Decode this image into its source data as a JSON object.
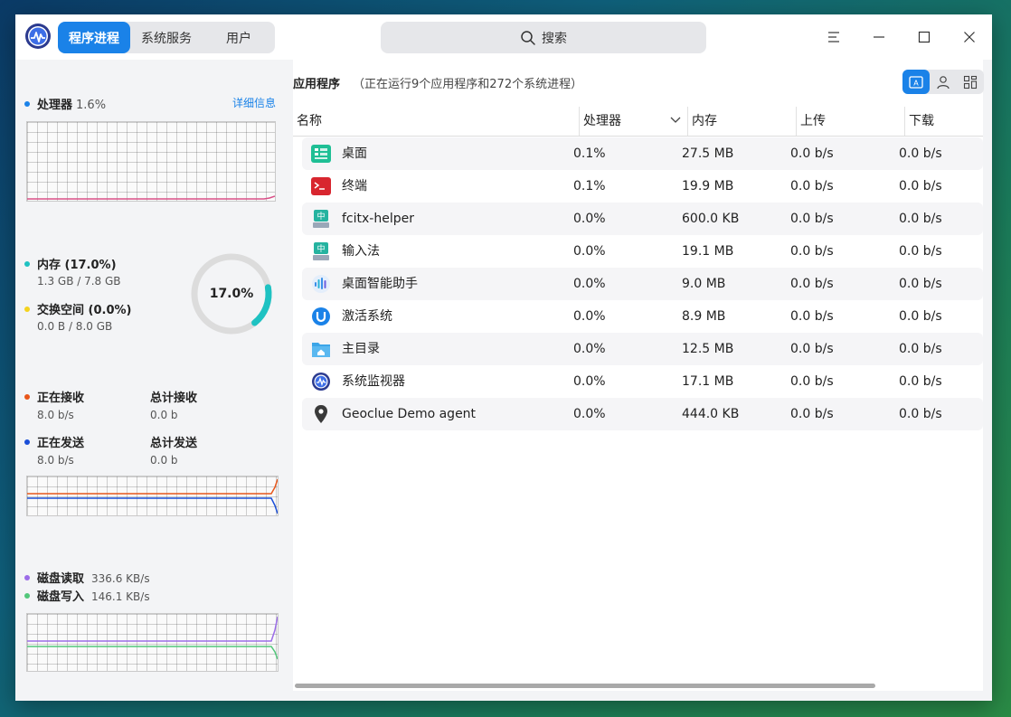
{
  "tabs": [
    {
      "label": "程序进程",
      "active": true
    },
    {
      "label": "系统服务",
      "active": false
    },
    {
      "label": "用户",
      "active": false
    }
  ],
  "search": {
    "label": "搜索",
    "icon": "search-icon"
  },
  "colors": {
    "accent": "#1a82e8",
    "cpu": "#1a82e8",
    "cpu_line": "#d94f87",
    "memory": "#1ec2c2",
    "swap": "#f4d31e",
    "net_recv": "#e8561a",
    "net_send": "#1a4ed8",
    "disk_read": "#9b6ce8",
    "disk_write": "#52c77a"
  },
  "cpu": {
    "label": "处理器",
    "value": "1.6%",
    "detail_link": "详细信息"
  },
  "memory": {
    "label": "内存 (17.0%)",
    "usage": "1.3 GB / 7.8 GB",
    "swap_label": "交换空间 (0.0%)",
    "swap_usage": "0.0 B / 8.0 GB",
    "ring_percent": 17.0,
    "ring_label": "17.0%"
  },
  "network": {
    "recv_label": "正在接收",
    "recv_value": "8.0 b/s",
    "recv_total_label": "总计接收",
    "recv_total_value": "0.0 b",
    "send_label": "正在发送",
    "send_value": "8.0 b/s",
    "send_total_label": "总计发送",
    "send_total_value": "0.0 b"
  },
  "disk": {
    "read_label": "磁盘读取",
    "read_value": "336.6 KB/s",
    "write_label": "磁盘写入",
    "write_value": "146.1 KB/s"
  },
  "main": {
    "title": "应用程序",
    "summary": "（正在运行9个应用程序和272个系统进程）",
    "columns": [
      "名称",
      "处理器",
      "内存",
      "上传",
      "下载"
    ],
    "rows": [
      {
        "name": "桌面",
        "cpu": "0.1%",
        "mem": "27.5 MB",
        "up": "0.0 b/s",
        "down": "0.0 b/s",
        "icon": "desktop-icon"
      },
      {
        "name": "终端",
        "cpu": "0.1%",
        "mem": "19.9 MB",
        "up": "0.0 b/s",
        "down": "0.0 b/s",
        "icon": "terminal-icon"
      },
      {
        "name": "fcitx-helper",
        "cpu": "0.0%",
        "mem": "600.0 KB",
        "up": "0.0 b/s",
        "down": "0.0 b/s",
        "icon": "input-method-icon"
      },
      {
        "name": "输入法",
        "cpu": "0.0%",
        "mem": "19.1 MB",
        "up": "0.0 b/s",
        "down": "0.0 b/s",
        "icon": "input-method-icon"
      },
      {
        "name": "桌面智能助手",
        "cpu": "0.0%",
        "mem": "9.0 MB",
        "up": "0.0 b/s",
        "down": "0.0 b/s",
        "icon": "assistant-icon"
      },
      {
        "name": "激活系统",
        "cpu": "0.0%",
        "mem": "8.9 MB",
        "up": "0.0 b/s",
        "down": "0.0 b/s",
        "icon": "activation-icon"
      },
      {
        "name": "主目录",
        "cpu": "0.0%",
        "mem": "12.5 MB",
        "up": "0.0 b/s",
        "down": "0.0 b/s",
        "icon": "home-folder-icon"
      },
      {
        "name": "系统监视器",
        "cpu": "0.0%",
        "mem": "17.1 MB",
        "up": "0.0 b/s",
        "down": "0.0 b/s",
        "icon": "system-monitor-icon"
      },
      {
        "name": "Geoclue Demo agent",
        "cpu": "0.0%",
        "mem": "444.0 KB",
        "up": "0.0 b/s",
        "down": "0.0 b/s",
        "icon": "location-pin-icon"
      }
    ]
  }
}
